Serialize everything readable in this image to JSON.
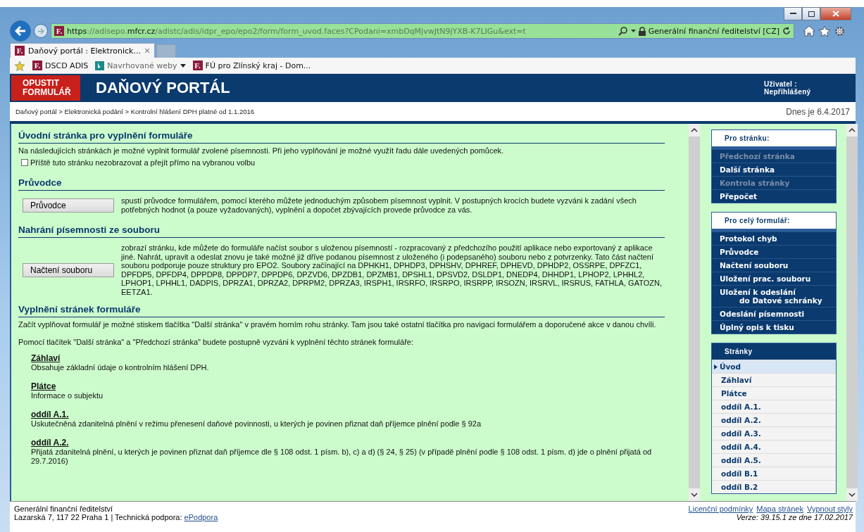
{
  "browser": {
    "logo": "F.",
    "url": [
      {
        "text": "https",
        "strong": true
      },
      {
        "text": "://adisepo.",
        "strong": false
      },
      {
        "text": "mfcr.cz",
        "strong": true
      },
      {
        "text": "/adistc/adis/idpr_epo/epo2/form/form_uvod.faces?CPodani=xmbDqMjvwJtN9jYXB-K7LIGu&ext=t",
        "strong": false
      }
    ],
    "site_identity": "Generální finanční ředitelství [CZ]",
    "tabs": [
      {
        "logo": "F.",
        "title": "Daňový portál : Elektronick...",
        "close": "×",
        "selected": true
      }
    ],
    "favorites": [
      {
        "label": "DSCD ADIS",
        "kind": "site",
        "logo": "F.",
        "dropdown": false
      },
      {
        "label": "Navrhované weby",
        "kind": "bing",
        "dropdown": true
      },
      {
        "label": "FÚ pro Zlínský kraj - Dom...",
        "kind": "site",
        "logo": "F.",
        "dropdown": false
      }
    ]
  },
  "header": {
    "exit_button": "OPUSTIT FORMULÁŘ",
    "title": "DAŇOVÝ PORTÁL",
    "user_label": "Uživatel :",
    "user_value": "Nepřihlášený"
  },
  "breadcrumb": "Daňový portál > Elektronická podání > Kontrolní hlášení DPH platné od 1.1.2016",
  "date": "Dnes je 6.4.2017",
  "content": {
    "title": "Úvodní stránka pro vyplnění formuláře",
    "intro": "Na následujících stránkách je možné vyplnit formulář zvolené písemnosti. Při jeho vyplňování je možné využít řadu dále uvedených pomůcek.",
    "skip_checkbox": {
      "label": "Příště tuto stránku nezobrazovat a přejít přímo na vybranou volbu",
      "checked": false
    },
    "sections": [
      {
        "title": "Průvodce",
        "button": "Průvodce",
        "text": "spustí průvodce formulářem, pomocí kterého můžete jednoduchým způsobem písemnost vyplnit. V postupných krocích budete vyzváni k zadání všech potřebných hodnot (a pouze vyžadovaných), vyplnění a dopočet zbývajících provede průvodce za vás."
      },
      {
        "title": "Nahrání písemnosti ze souboru",
        "button": "Načtení souboru",
        "text": "zobrazí stránku, kde můžete do formuláře načíst soubor s uloženou písemností - rozpracovaný z předchozího použití aplikace nebo exportovaný z aplikace jiné. Nahrát, upravit a odeslat znovu je také možné již dříve podanou písemnost z uloženého (i podepsaného) souboru nebo z potvrzenky. Tato část načtení souboru podporuje pouze struktury pro EPO2. Soubory začínající na DPHKH1, DPHDP3, DPHSHV, DPHREF, DPHEVD, DPHDP2, OSSRPE, DPFZC1, DPFDP5, DPFDP4, DPPDP8, DPPDP7, DPPDP6, DPZVD6, DPZDB1, DPZMB1, DPSHL1, DPSVD2, DSLDP1, DNEDP4, DHHDP1, LPHOP2, LPHHL2, LPHOP1, LPHHL1, DADPIS, DPRZA1, DPRZA2, DPRPM2, DPRZA3, IRSPH1, IRSRFO, IRSRPO, IRSRPP, IRSOZN, IRSRVL, IRSRUS, FATHLA, GATOZN, EETZA1."
      }
    ],
    "fill_title": "Vyplnění stránek formuláře",
    "fill_paragraphs": [
      "Začít vyplňovat formulář je možné stiskem tlačítka \"Další stránka\" v pravém horním rohu stránky. Tam jsou také ostatní tlačítka pro navigaci formulářem a doporučené akce v danou chvíli.",
      "Pomocí tlačítek \"Další stránka\" a \"Předchozí stránka\" budete postupně vyzváni k vyplnění těchto stránek formuláře:"
    ],
    "pages": [
      {
        "title": "Záhlaví",
        "text": "Obsahuje základní údaje o kontrolním hlášení DPH."
      },
      {
        "title": "Plátce",
        "text": "Informace o subjektu"
      },
      {
        "title": "oddíl A.1.",
        "text": "Uskutečněná zdanitelná plnění v režimu přenesení daňové povinnosti, u kterých je povinen přiznat daň příjemce plnění podle § 92a"
      },
      {
        "title": "oddíl A.2.",
        "text": "Přijatá zdanitelná plnění, u kterých je povinen přiznat daň příjemce dle § 108 odst. 1 písm. b), c) a d) (§ 24, § 25) (v případě plnění podle § 108 odst. 1 písm. d) jde o plnění přijatá od 29.7.2016)"
      }
    ]
  },
  "sidebar": {
    "page_panel": {
      "title": "Pro stránku:",
      "items": [
        {
          "label": "Předchozí stránka",
          "disabled": true
        },
        {
          "label": "Další stránka",
          "disabled": false
        },
        {
          "label": "Kontrola stránky",
          "disabled": true
        },
        {
          "label": "Přepočet",
          "disabled": false
        }
      ]
    },
    "form_panel": {
      "title": "Pro celý formulář:",
      "items": [
        {
          "label": "Protokol chyb",
          "disabled": false
        },
        {
          "label": "Průvodce",
          "disabled": false
        },
        {
          "label": "Načtení souboru",
          "disabled": false
        },
        {
          "label": "Uložení prac. souboru",
          "disabled": false
        },
        {
          "label": "Uložení k odeslání",
          "label2": "do Datové schránky",
          "disabled": false
        },
        {
          "label": "Odeslání písemnosti",
          "disabled": false
        },
        {
          "label": "Úplný opis k tisku",
          "disabled": false
        }
      ]
    },
    "pages_panel": {
      "title": "Stránky",
      "items": [
        {
          "label": "Úvod",
          "selected": true
        },
        {
          "label": "Záhlaví",
          "selected": false
        },
        {
          "label": "Plátce",
          "selected": false
        },
        {
          "label": "oddíl A.1.",
          "selected": false
        },
        {
          "label": "oddíl A.2.",
          "selected": false
        },
        {
          "label": "oddíl A.3.",
          "selected": false
        },
        {
          "label": "oddíl A.4.",
          "selected": false
        },
        {
          "label": "oddíl A.5.",
          "selected": false
        },
        {
          "label": "oddíl B.1",
          "selected": false
        },
        {
          "label": "oddíl B.2",
          "selected": false
        }
      ]
    }
  },
  "footer": {
    "org": "Generální finanční ředitelství",
    "address": "Lazarská 7, 117 22 Praha 1 | Technická podpora:",
    "support_link": "ePodpora",
    "links": [
      "Licenční podmínky",
      "Mapa stránek",
      "Vypnout styly"
    ],
    "version": "Verze: 39.15.1 ze dne 17.02.2017"
  }
}
